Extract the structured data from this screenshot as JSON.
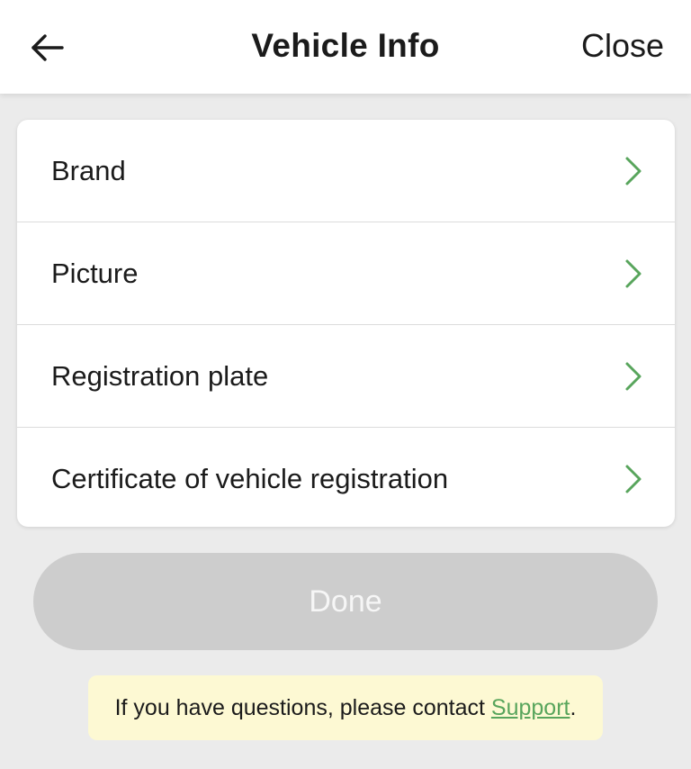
{
  "header": {
    "back_icon": "arrow-left-icon",
    "title": "Vehicle Info",
    "close_label": "Close"
  },
  "menu": {
    "items": [
      {
        "label": "Brand",
        "icon": "chevron-right-icon"
      },
      {
        "label": "Picture",
        "icon": "chevron-right-icon"
      },
      {
        "label": "Registration plate",
        "icon": "chevron-right-icon"
      },
      {
        "label": "Certificate of vehicle registration",
        "icon": "chevron-right-icon"
      }
    ]
  },
  "actions": {
    "done_label": "Done",
    "done_enabled": false
  },
  "notice": {
    "text_before": "If you have questions, please contact ",
    "link_label": "Support",
    "text_after": "."
  },
  "colors": {
    "accent": "#58a55c",
    "background": "#ebebeb",
    "notice_bg": "#fdf9d3",
    "disabled_button": "#cdcdcd"
  }
}
